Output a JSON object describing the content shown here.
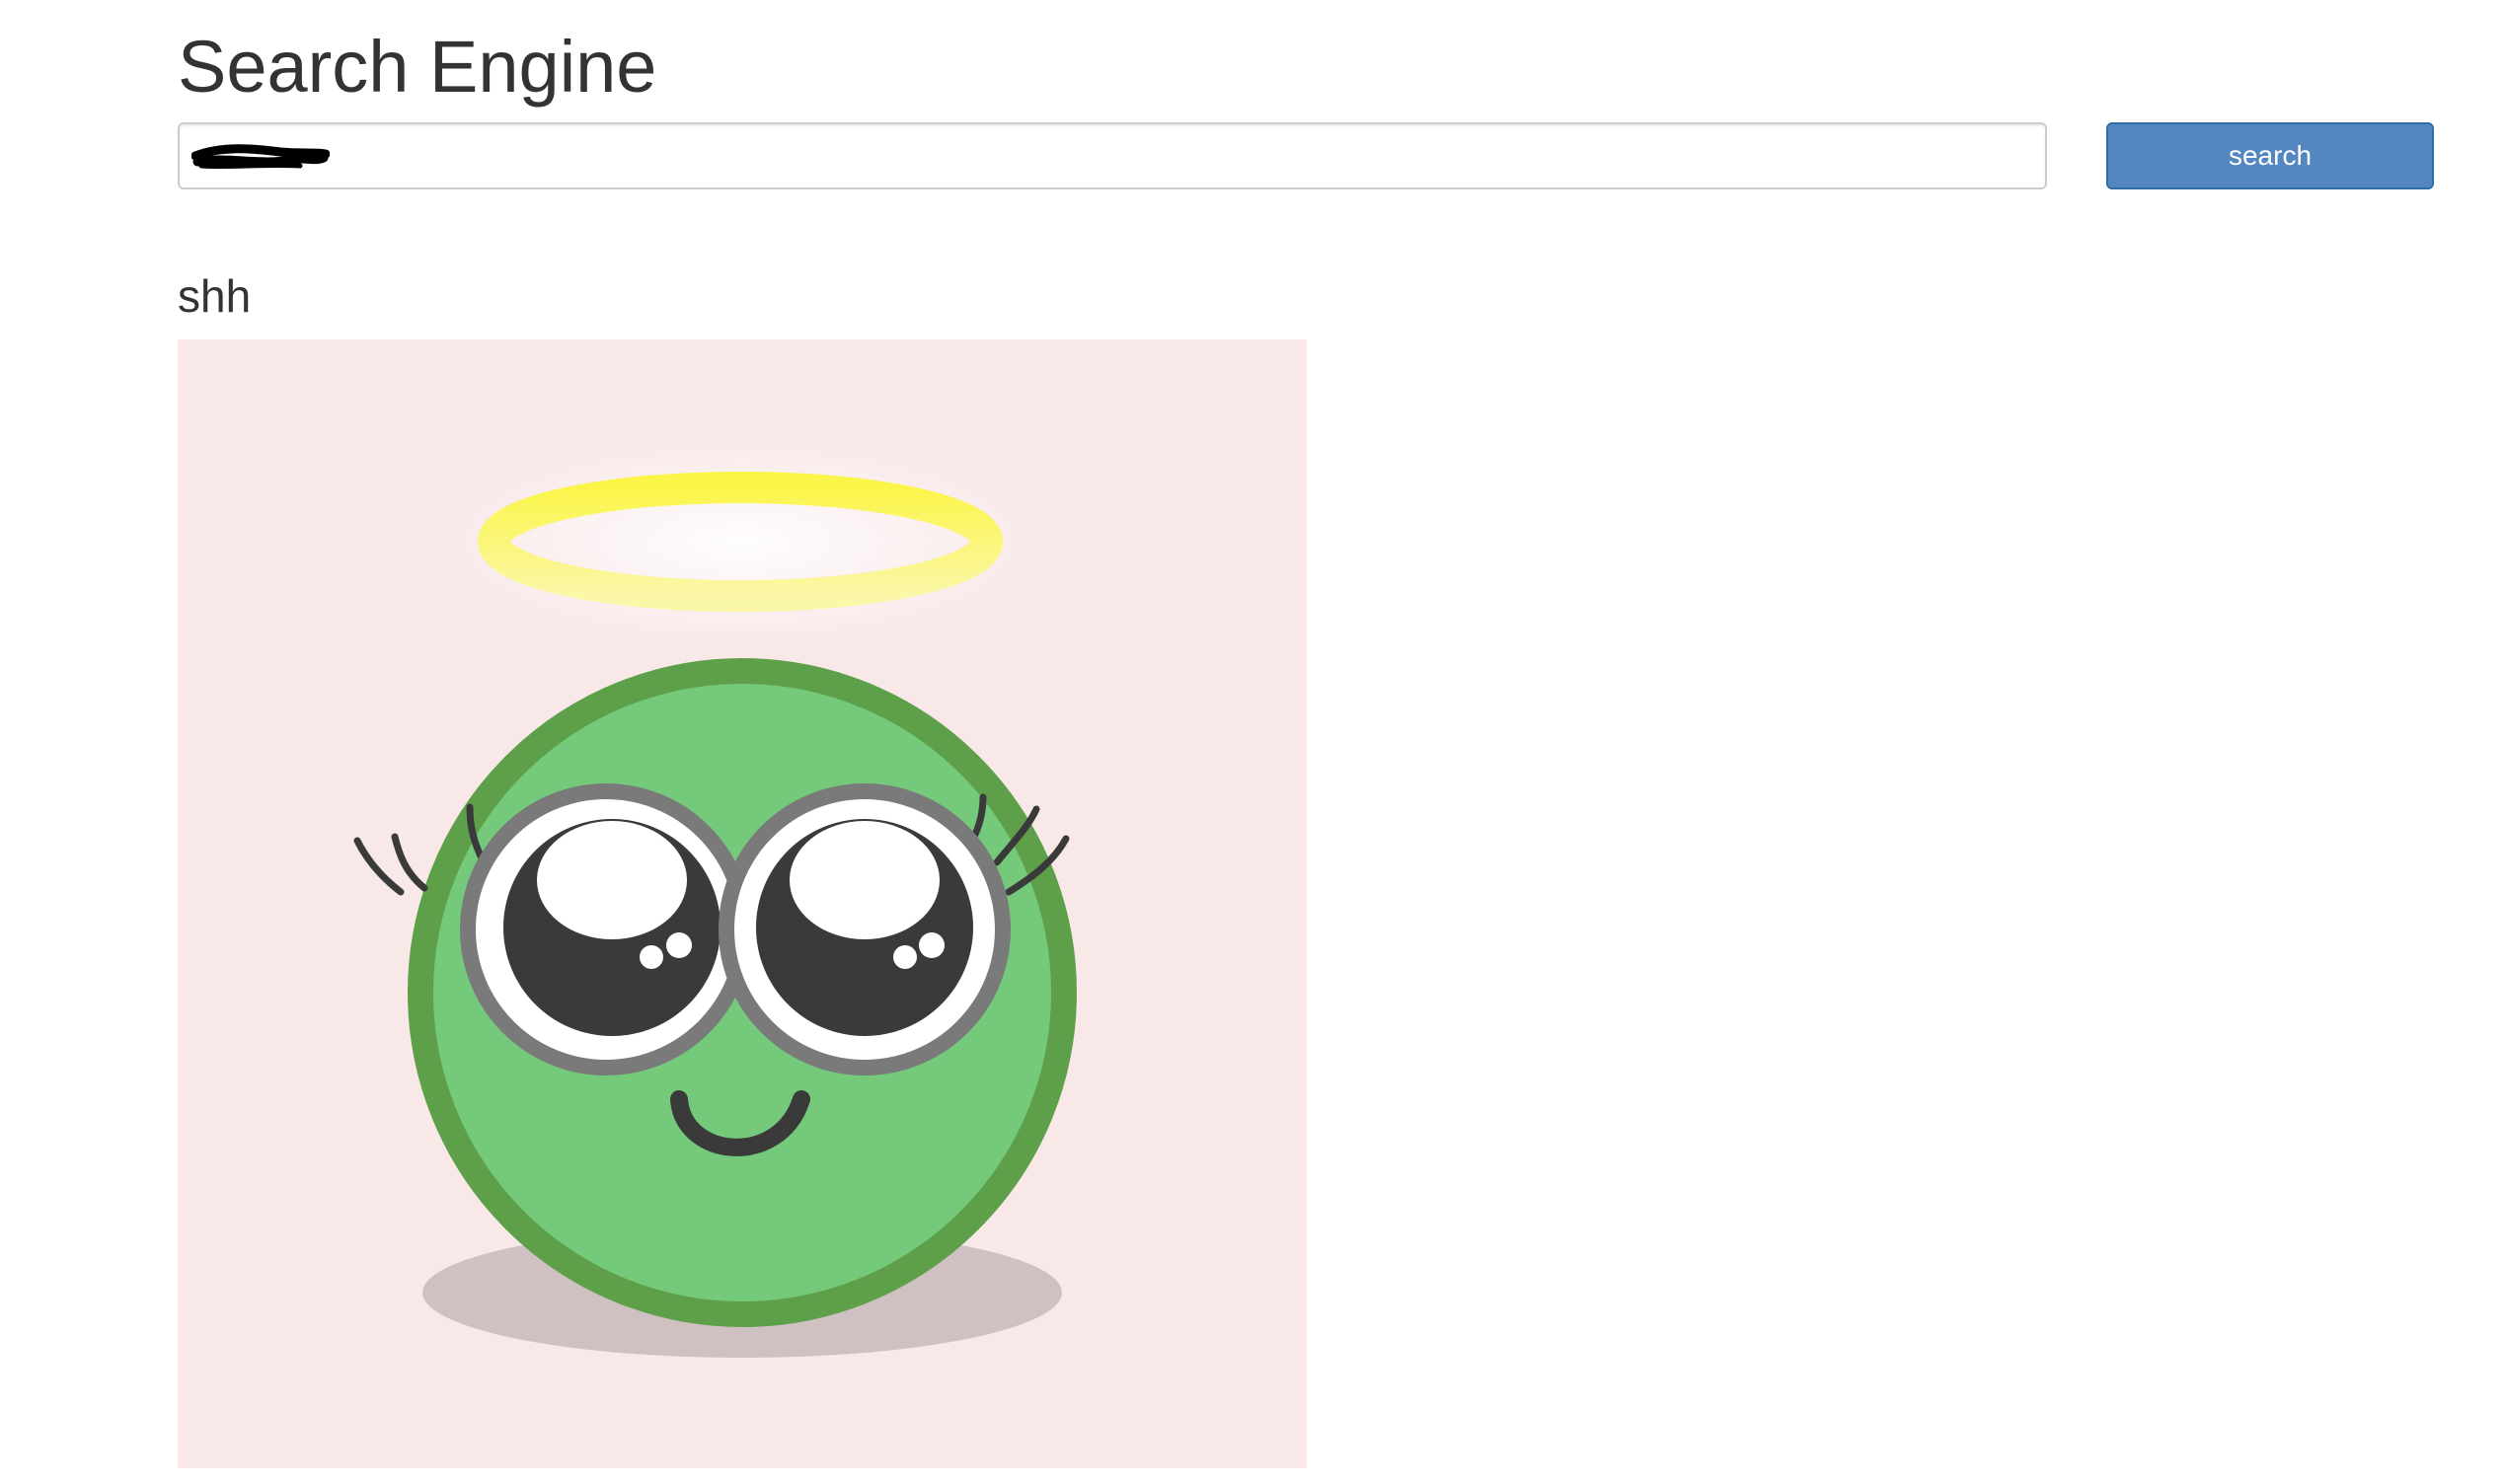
{
  "header": {
    "title": "Search Engine"
  },
  "search": {
    "value": "",
    "button_label": "search"
  },
  "results": [
    {
      "title": "shh",
      "image_subject": "green smiley face with halo"
    }
  ],
  "colors": {
    "button_bg": "#5487c2",
    "image_bg": "#f8e8e8",
    "face_fill": "#74c97b",
    "face_outline": "#5ea04a",
    "halo": "#fbf25a"
  }
}
